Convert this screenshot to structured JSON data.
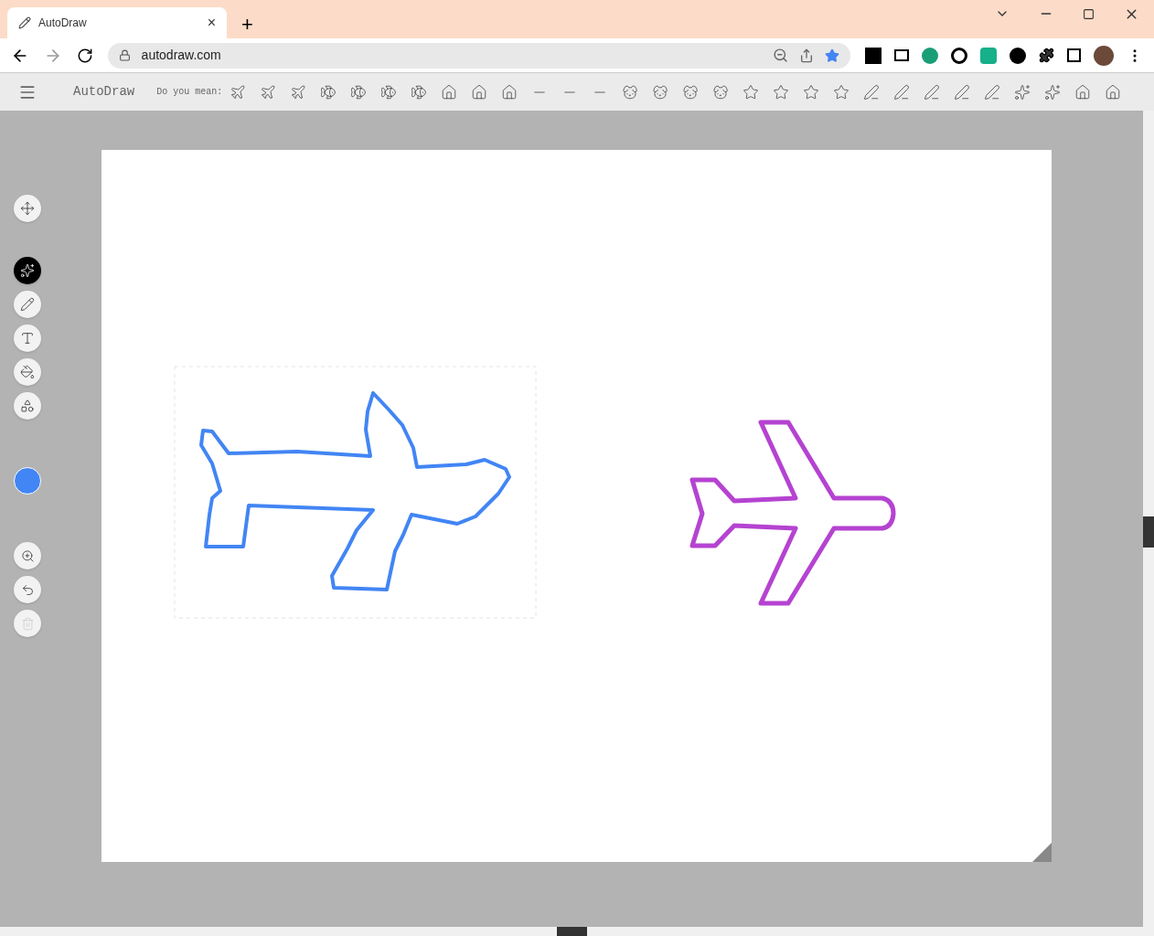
{
  "browser": {
    "tab": {
      "title": "AutoDraw",
      "close": "×"
    },
    "new_tab": "+",
    "url": "autodraw.com"
  },
  "toolbar": {
    "app_title": "AutoDraw",
    "suggestion_label": "Do you mean:"
  },
  "tools": [
    {
      "kind": "move",
      "selected": false
    },
    {
      "kind": "autodraw",
      "selected": true
    },
    {
      "kind": "draw",
      "selected": false
    },
    {
      "kind": "type",
      "selected": false
    },
    {
      "kind": "fill",
      "selected": false
    },
    {
      "kind": "shape",
      "selected": false
    }
  ],
  "color": {
    "color": "#4285f4"
  },
  "actions": [
    {
      "kind": "zoom",
      "disabled": false
    },
    {
      "kind": "undo",
      "disabled": false
    },
    {
      "kind": "delete",
      "disabled": true
    }
  ]
}
